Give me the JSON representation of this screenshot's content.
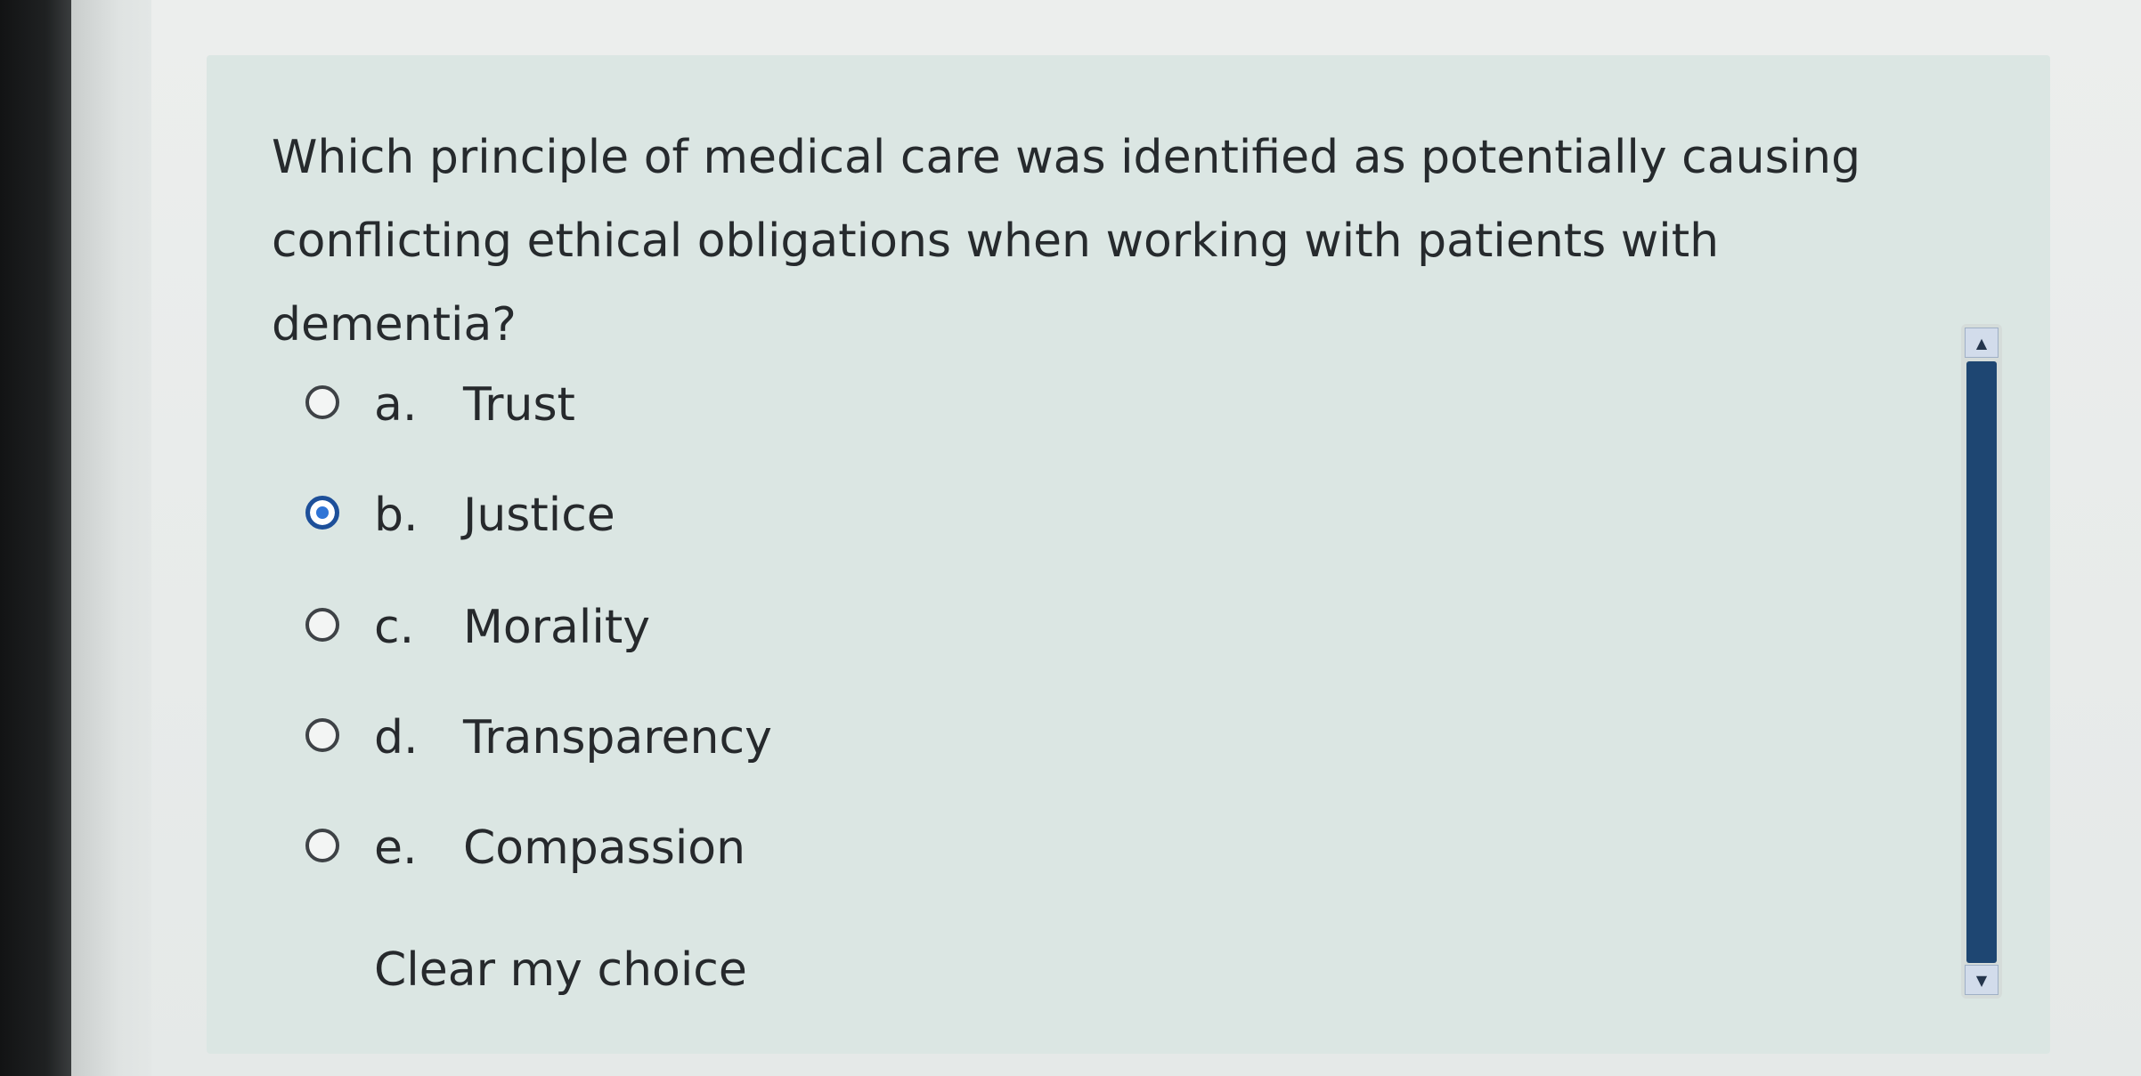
{
  "question": {
    "text": "Which principle of medical care was identified as potentially causing conflicting ethical obligations when working with patients with dementia?"
  },
  "answers": [
    {
      "letter": "a.",
      "label": "Trust",
      "selected": false
    },
    {
      "letter": "b.",
      "label": "Justice",
      "selected": true
    },
    {
      "letter": "c.",
      "label": "Morality",
      "selected": false
    },
    {
      "letter": "d.",
      "label": "Transparency",
      "selected": false
    },
    {
      "letter": "e.",
      "label": "Compassion",
      "selected": false
    }
  ],
  "clear_choice_label": "Clear my choice",
  "scrollbar": {
    "up_icon": "triangle-up-icon",
    "down_icon": "triangle-down-icon"
  },
  "colors": {
    "panel_background": "#dbe6e3",
    "selected_radio": "#2f74d6",
    "scroll_thumb": "#1e4672"
  }
}
